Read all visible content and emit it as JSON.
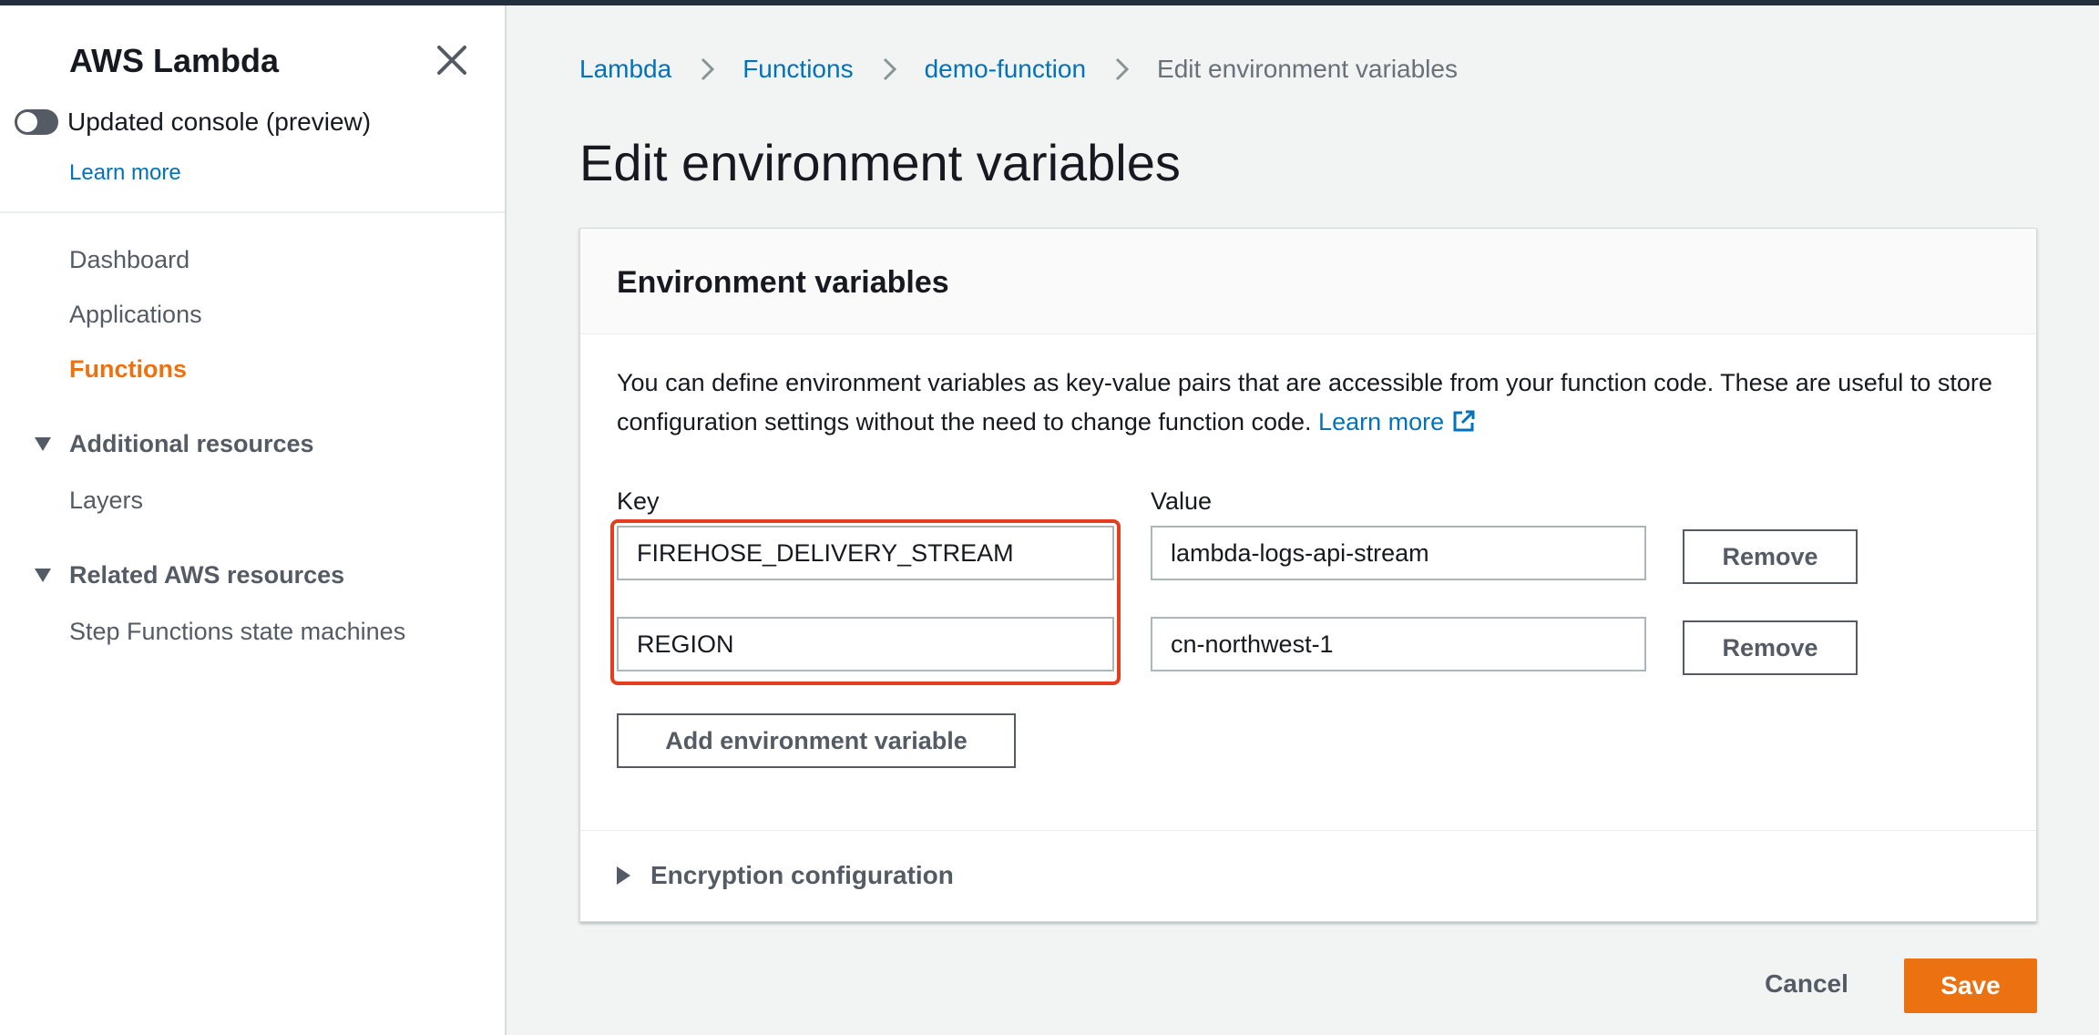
{
  "sidebar": {
    "title": "AWS Lambda",
    "toggle_label": "Updated console (preview)",
    "learn_more": "Learn more",
    "items": [
      {
        "label": "Dashboard"
      },
      {
        "label": "Applications"
      },
      {
        "label": "Functions",
        "active": true
      }
    ],
    "section_additional": "Additional resources",
    "layers": "Layers",
    "section_related": "Related AWS resources",
    "step_functions": "Step Functions state machines"
  },
  "breadcrumb": [
    "Lambda",
    "Functions",
    "demo-function",
    "Edit environment variables"
  ],
  "page_title": "Edit environment variables",
  "panel": {
    "title": "Environment variables",
    "description": "You can define environment variables as key-value pairs that are accessible from your function code. These are useful to store configuration settings without the need to change function code.",
    "learn_more": "Learn more",
    "key_label": "Key",
    "value_label": "Value",
    "variables": [
      {
        "key": "FIREHOSE_DELIVERY_STREAM",
        "value": "lambda-logs-api-stream",
        "remove": "Remove"
      },
      {
        "key": "REGION",
        "value": "cn-northwest-1",
        "remove": "Remove"
      }
    ],
    "add_button": "Add environment variable",
    "encryption": "Encryption configuration"
  },
  "footer": {
    "cancel": "Cancel",
    "save": "Save"
  },
  "colors": {
    "accent": "#ec7211",
    "link": "#0073bb",
    "highlight": "#e53d1f"
  }
}
